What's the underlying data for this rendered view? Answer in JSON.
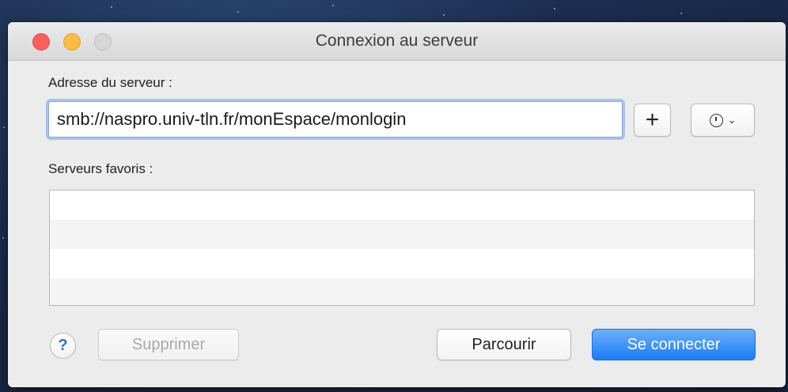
{
  "window": {
    "title": "Connexion au serveur"
  },
  "address": {
    "label": "Adresse du serveur :",
    "value": "smb://naspro.univ-tln.fr/monEspace/monlogin"
  },
  "buttons": {
    "add_label": "+",
    "history_icon": "clock-icon",
    "history_chevron": "⌄",
    "help_label": "?",
    "delete_label": "Supprimer",
    "browse_label": "Parcourir",
    "connect_label": "Se connecter"
  },
  "favorites": {
    "label": "Serveurs favoris :",
    "items": []
  },
  "colors": {
    "accent": "#1a7cf5",
    "close": "#fc605c",
    "minimize": "#fdbc40"
  }
}
